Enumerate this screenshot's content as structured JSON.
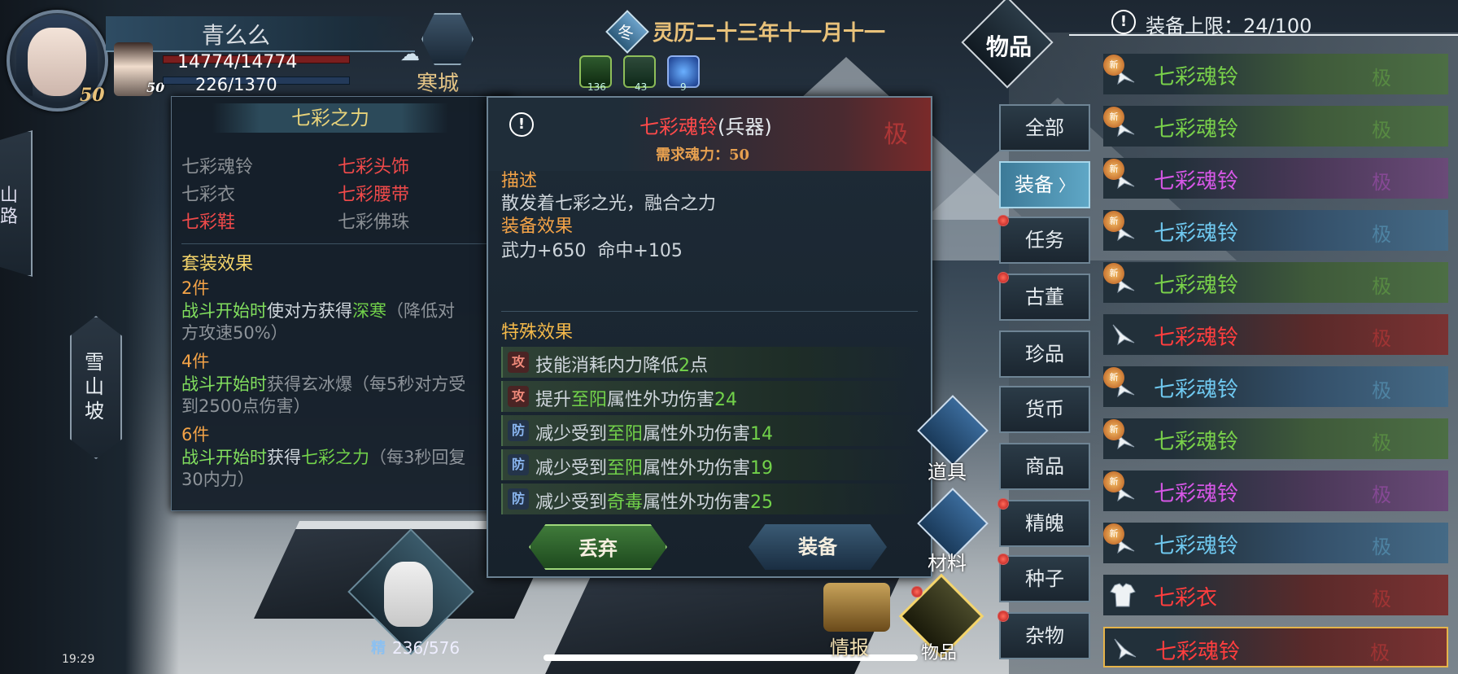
{
  "player": {
    "name": "青么么",
    "hp": "14774/14774",
    "mp": "226/1370",
    "level": "50",
    "companion_level": "50",
    "location": "寒城"
  },
  "date": {
    "season": "冬",
    "text": "灵历二十三年十一月十一"
  },
  "buffs": [
    "136",
    "43",
    "9"
  ],
  "left_nav": {
    "road": "山路",
    "slope": "雪山坡"
  },
  "set_panel": {
    "title": "七彩之力",
    "pieces": [
      {
        "name": "七彩魂铃",
        "owned": true
      },
      {
        "name": "七彩头饰",
        "owned": false
      },
      {
        "name": "七彩衣",
        "owned": true
      },
      {
        "name": "七彩腰带",
        "owned": false
      },
      {
        "name": "七彩鞋",
        "owned": false
      },
      {
        "name": "七彩佛珠",
        "owned": true
      }
    ],
    "effect_title": "套装效果",
    "tier2": {
      "count": "2件",
      "trigger": "战斗开始时",
      "a": "使对方获得",
      "b": "深寒",
      "c": "（降低对",
      "d": "方攻速50%）"
    },
    "tier4": {
      "count": "4件",
      "trigger": "战斗开始时",
      "a": "获得玄冰爆（每5秒对方受",
      "b": "到2500点伤害）"
    },
    "tier6": {
      "count": "6件",
      "trigger": "战斗开始时",
      "a": "获得",
      "b": "七彩之力",
      "c": "（每3秒回复",
      "d": "30内力）"
    }
  },
  "item": {
    "name": "七彩魂铃",
    "type": "(兵器)",
    "grade": "极",
    "requirement": "需求魂力：50",
    "desc_title": "描述",
    "desc": "散发着七彩之光，融合之力",
    "effect_title": "装备效果",
    "effect": "武力+650  命中+105",
    "special_title": "特殊效果",
    "specials": [
      {
        "tag": "攻",
        "kind": "atk",
        "a": "技能消耗内力降低",
        "b": "2",
        "c": "点",
        "d": "",
        "e": ""
      },
      {
        "tag": "攻",
        "kind": "atk",
        "a": "提升",
        "b": "至阳",
        "c": "属性外功伤害",
        "d": "24",
        "e": ""
      },
      {
        "tag": "防",
        "kind": "def",
        "a": "减少受到",
        "b": "至阳",
        "c": "属性外功伤害",
        "d": "14",
        "e": ""
      },
      {
        "tag": "防",
        "kind": "def",
        "a": "减少受到",
        "b": "至阳",
        "c": "属性外功伤害",
        "d": "19",
        "e": ""
      },
      {
        "tag": "防",
        "kind": "def",
        "a": "减少受到",
        "b": "奇毒",
        "c": "属性外功伤害",
        "d": "25",
        "e": ""
      }
    ],
    "discard_label": "丢弃",
    "equip_label": "装备"
  },
  "inventory": {
    "title": "物品",
    "limit": "装备上限：24/100",
    "categories": [
      "全部",
      "装备",
      "任务",
      "古董",
      "珍品",
      "货币",
      "商品",
      "精魄",
      "种子",
      "杂物"
    ],
    "active_category": "装备",
    "items": [
      {
        "name": "七彩魂铃",
        "color": "green",
        "new": true
      },
      {
        "name": "七彩魂铃",
        "color": "green",
        "new": true
      },
      {
        "name": "七彩魂铃",
        "color": "purple",
        "new": true
      },
      {
        "name": "七彩魂铃",
        "color": "cyan",
        "new": true
      },
      {
        "name": "七彩魂铃",
        "color": "green",
        "new": true
      },
      {
        "name": "七彩魂铃",
        "color": "red",
        "new": false
      },
      {
        "name": "七彩魂铃",
        "color": "cyan",
        "new": true
      },
      {
        "name": "七彩魂铃",
        "color": "green",
        "new": true
      },
      {
        "name": "七彩魂铃",
        "color": "purple",
        "new": true
      },
      {
        "name": "七彩魂铃",
        "color": "cyan",
        "new": true
      },
      {
        "name": "七彩衣",
        "color": "red",
        "new": false
      },
      {
        "name": "七彩魂铃",
        "color": "red",
        "new": false
      }
    ],
    "grade_mark": "极",
    "new_mark": "新"
  },
  "bottom_menu": {
    "props": "道具",
    "materials": "材料",
    "intel": "情报",
    "items": "物品",
    "stamina_label": "精",
    "stamina": "236/576",
    "time": "19:29"
  },
  "colors": {
    "gold": "#f4d46a",
    "orange": "#f4a347",
    "green": "#72d24a",
    "red": "#f04a4a",
    "cyan": "#6fc8ef",
    "purple": "#d657e6"
  }
}
